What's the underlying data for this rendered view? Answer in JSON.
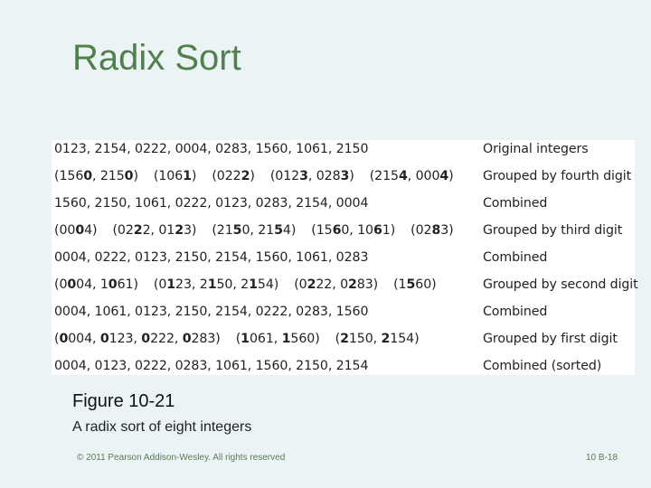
{
  "slide": {
    "title": "Radix Sort",
    "background_color": "#EBF4F4",
    "title_color": "#527F4E"
  },
  "figure": {
    "rows": [
      {
        "kind": "list",
        "values": "0123, 2154, 0222, 0004, 0283, 1560, 1061, 2150",
        "description": "Original integers"
      },
      {
        "kind": "groups",
        "highlight_digit": 4,
        "groups": [
          [
            "1560",
            "2150"
          ],
          [
            "1061"
          ],
          [
            "0222"
          ],
          [
            "0123",
            "0283"
          ],
          [
            "2154",
            "0004"
          ]
        ],
        "description": "Grouped by fourth digit"
      },
      {
        "kind": "list",
        "values": "1560, 2150, 1061, 0222, 0123, 0283, 2154, 0004",
        "description": "Combined"
      },
      {
        "kind": "groups",
        "highlight_digit": 3,
        "groups": [
          [
            "0004"
          ],
          [
            "0222",
            "0123"
          ],
          [
            "2150",
            "2154"
          ],
          [
            "1560",
            "1061"
          ],
          [
            "0283"
          ]
        ],
        "description": "Grouped by third digit"
      },
      {
        "kind": "list",
        "values": "0004, 0222, 0123, 2150, 2154, 1560, 1061, 0283",
        "description": "Combined"
      },
      {
        "kind": "groups",
        "highlight_digit": 2,
        "groups": [
          [
            "0004",
            "1061"
          ],
          [
            "0123",
            "2150",
            "2154"
          ],
          [
            "0222",
            "0283"
          ],
          [
            "1560"
          ]
        ],
        "description": "Grouped by second digit"
      },
      {
        "kind": "list",
        "values": "0004, 1061, 0123, 2150, 2154, 0222, 0283, 1560",
        "description": "Combined"
      },
      {
        "kind": "groups",
        "highlight_digit": 1,
        "groups": [
          [
            "0004",
            "0123",
            "0222",
            "0283"
          ],
          [
            "1061",
            "1560"
          ],
          [
            "2150",
            "2154"
          ]
        ],
        "description": "Grouped by first digit"
      },
      {
        "kind": "list",
        "values": "0004, 0123, 0222, 0283, 1061, 1560, 2150, 2154",
        "description": "Combined (sorted)"
      }
    ]
  },
  "caption": {
    "figure_label": "Figure 10-21",
    "text": "A radix sort of eight integers"
  },
  "footer": {
    "copyright": "© 2011 Pearson Addison-Wesley. All rights reserved",
    "page_number": "10 B-18"
  }
}
